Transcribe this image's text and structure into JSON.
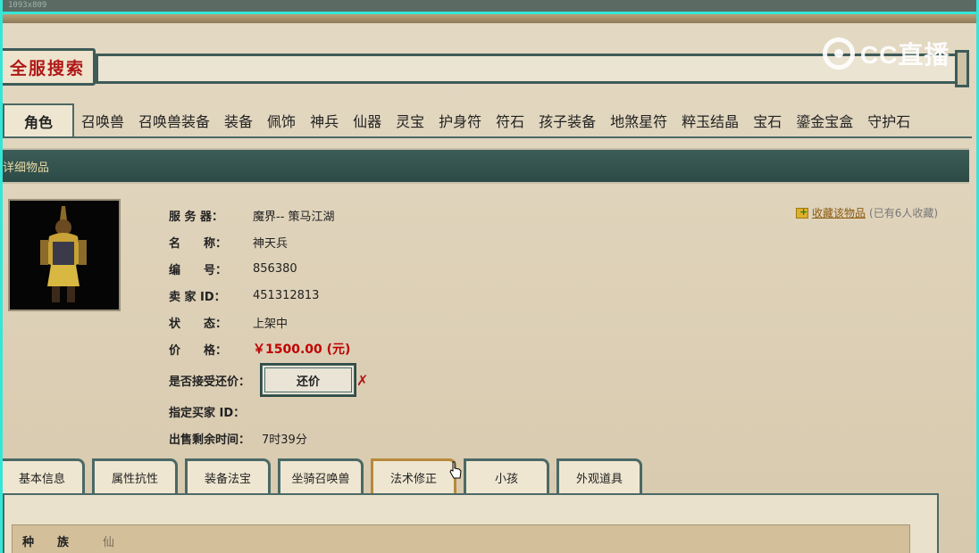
{
  "overlay": {
    "corner_text": "1093x809",
    "watermark": "CC直播"
  },
  "search": {
    "title": "全服搜索"
  },
  "categories": [
    {
      "label": "角色",
      "active": true
    },
    {
      "label": "召唤兽"
    },
    {
      "label": "召唤兽装备"
    },
    {
      "label": "装备"
    },
    {
      "label": "佩饰"
    },
    {
      "label": "神兵"
    },
    {
      "label": "仙器"
    },
    {
      "label": "灵宝"
    },
    {
      "label": "护身符"
    },
    {
      "label": "符石"
    },
    {
      "label": "孩子装备"
    },
    {
      "label": "地煞星符"
    },
    {
      "label": "粹玉结晶"
    },
    {
      "label": "宝石"
    },
    {
      "label": "鎏金宝盒"
    },
    {
      "label": "守护石"
    }
  ],
  "section": {
    "title": "详细物品"
  },
  "item": {
    "server_label": "服 务 器：",
    "server": "魔界-- 策马江湖",
    "name_label": "名　　称：",
    "name": "神天兵",
    "id_label": "编　　号：",
    "id": "856380",
    "seller_label": "卖 家 ID：",
    "seller": "451312813",
    "status_label": "状　　态：",
    "status": "上架中",
    "price_label": "价　　格：",
    "price": "￥1500.00 (元)",
    "bargain_label": "是否接受还价：",
    "bargain_button": "还价",
    "buyer_label": "指定买家 ID：",
    "buyer": "",
    "remaining_label": "出售剩余时间：",
    "remaining": "7时39分"
  },
  "favorite": {
    "link": "收藏该物品",
    "count": "(已有6人收藏)"
  },
  "detail_tabs": [
    {
      "label": "基本信息"
    },
    {
      "label": "属性抗性"
    },
    {
      "label": "装备法宝"
    },
    {
      "label": "坐骑召唤兽"
    },
    {
      "label": "法术修正",
      "active": true
    },
    {
      "label": "小孩"
    },
    {
      "label": "外观道具"
    }
  ],
  "basic": {
    "race_label": "种　　族",
    "race": "仙"
  }
}
